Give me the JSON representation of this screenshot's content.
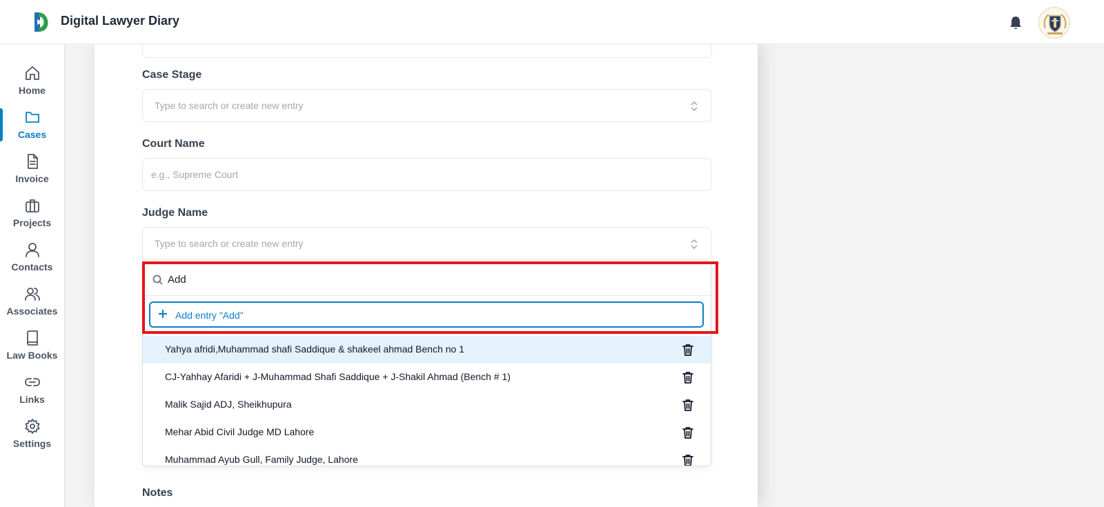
{
  "app": {
    "title": "Digital Lawyer Diary",
    "accent_color": "#0a7fc6",
    "highlight_color": "#e8141b"
  },
  "header": {
    "notification_icon": "bell-icon",
    "avatar_icon": "law-firm-crest"
  },
  "sidebar": {
    "active": "Cases",
    "items": [
      {
        "label": "Home",
        "icon": "home-icon"
      },
      {
        "label": "Cases",
        "icon": "folder-icon"
      },
      {
        "label": "Invoice",
        "icon": "document-icon"
      },
      {
        "label": "Projects",
        "icon": "briefcase-icon"
      },
      {
        "label": "Contacts",
        "icon": "user-icon"
      },
      {
        "label": "Associates",
        "icon": "users-icon"
      },
      {
        "label": "Law Books",
        "icon": "book-icon"
      },
      {
        "label": "Links",
        "icon": "link-icon"
      },
      {
        "label": "Settings",
        "icon": "gear-icon"
      }
    ]
  },
  "form": {
    "case_stage": {
      "label": "Case Stage",
      "placeholder": "Type to search or create new entry"
    },
    "court_name": {
      "label": "Court Name",
      "placeholder": "e.g., Supreme Court"
    },
    "judge_name": {
      "label": "Judge Name",
      "placeholder": "Type to search or create new entry",
      "dropdown": {
        "search_value": "Add",
        "add_entry_label": "Add entry \"Add\"",
        "options": [
          "Yahya afridi,Muhammad shafi Saddique & shakeel ahmad Bench no 1",
          "CJ-Yahhay Afaridi + J-Muhammad Shafi Saddique + J-Shakil Ahmad (Bench # 1)",
          "Malik Sajid ADJ, Sheikhupura",
          "Mehar Abid Civil Judge MD Lahore",
          "Muhammad Ayub Gull, Family Judge, Lahore"
        ]
      }
    },
    "notes": {
      "label": "Notes"
    }
  }
}
